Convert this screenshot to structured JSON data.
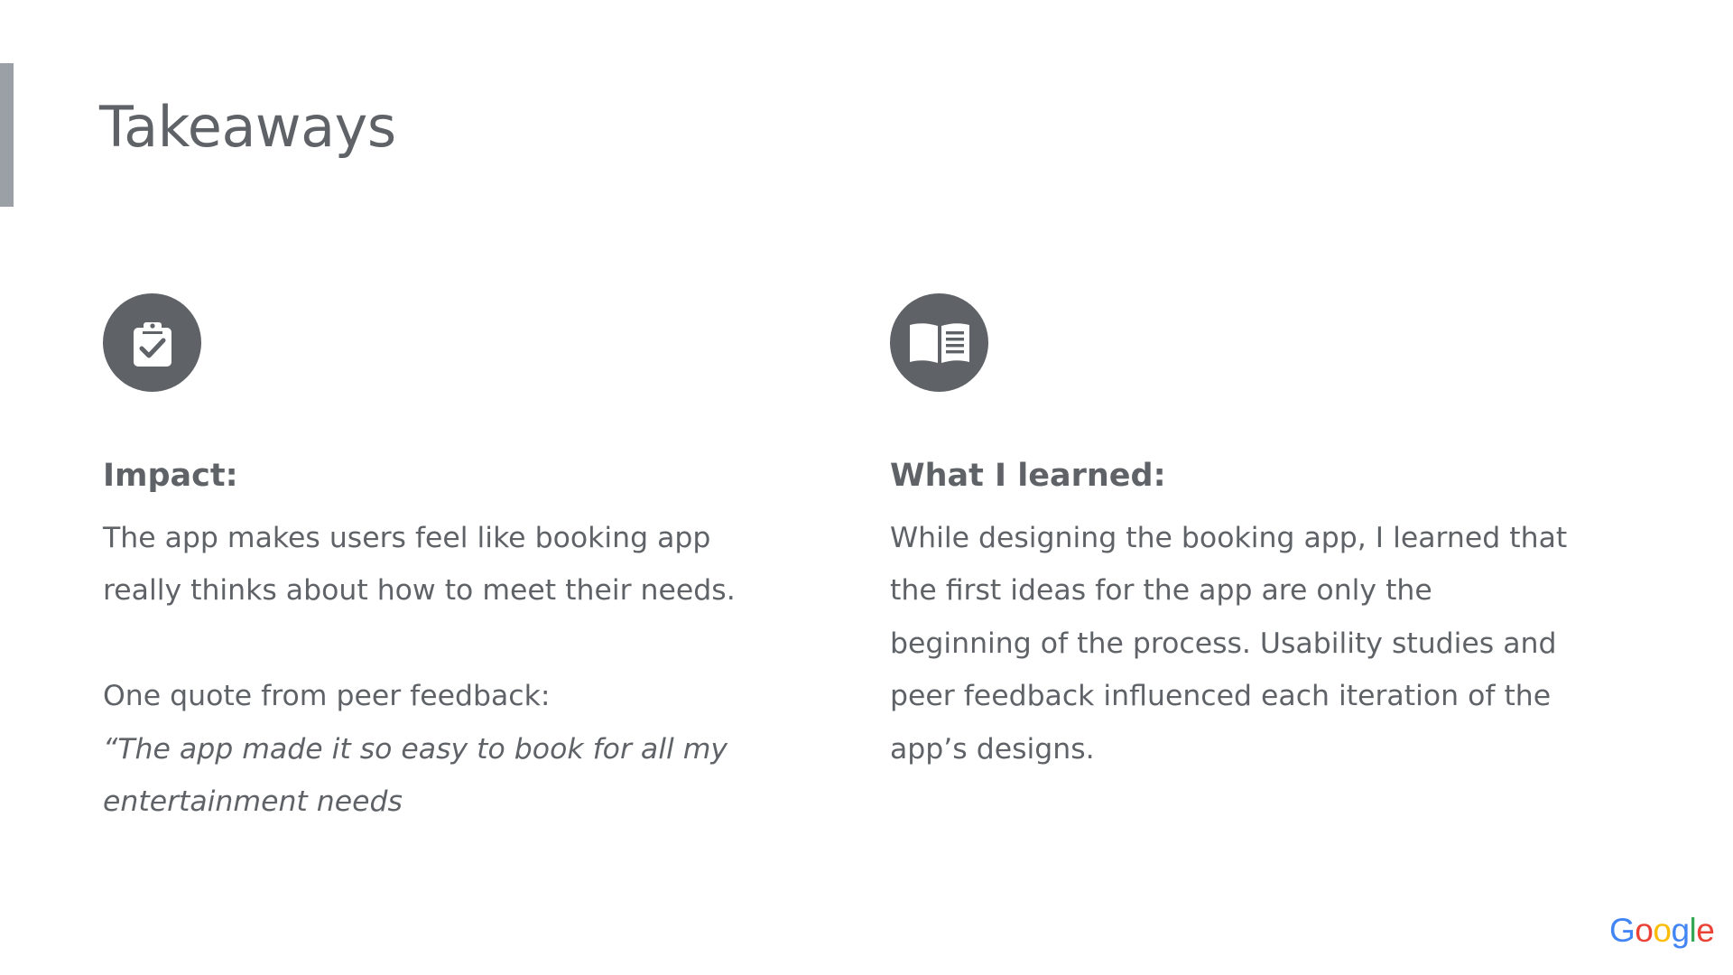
{
  "slide": {
    "title": "Takeaways"
  },
  "left": {
    "icon": "clipboard-check-icon",
    "heading": "Impact:",
    "paragraph_lines": [
      "The app makes users feel like booking app",
      "really thinks about how to meet their needs."
    ],
    "quote_intro": "One quote from peer feedback:",
    "quote_lines": [
      "“The app made it so easy to book for all my",
      "entertainment needs"
    ]
  },
  "right": {
    "icon": "open-book-icon",
    "heading": "What I learned:",
    "paragraph_lines": [
      "While designing the booking app, I learned that",
      "the first ideas for the app are only the",
      "beginning of the process. Usability studies and",
      "peer feedback influenced each iteration of the",
      "app’s designs."
    ]
  },
  "logo": {
    "letters": [
      "G",
      "o",
      "o",
      "g",
      "l",
      "e"
    ],
    "colors": [
      "#4285f4",
      "#ea4335",
      "#fbbc05",
      "#4285f4",
      "#34a853",
      "#ea4335"
    ]
  },
  "colors": {
    "text": "#5f6368",
    "icon_bg": "#5f6368",
    "accent_bar": "#9aa0a6",
    "background": "#ffffff"
  }
}
